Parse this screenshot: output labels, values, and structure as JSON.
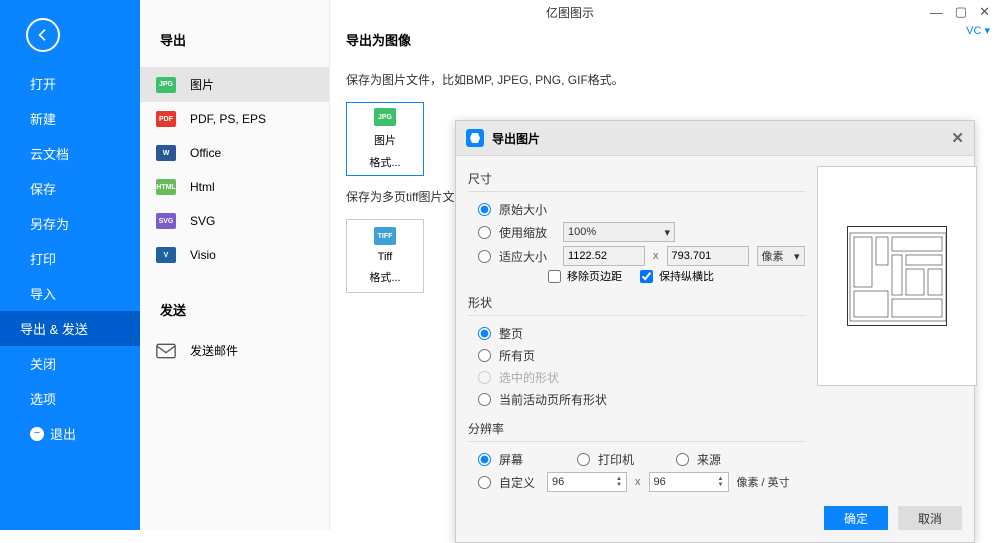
{
  "app": {
    "title": "亿图图示",
    "vc": "VC ▾"
  },
  "sidebar": {
    "items": [
      "打开",
      "新建",
      "云文档",
      "保存",
      "另存为",
      "打印",
      "导入",
      "导出 & 发送",
      "关闭",
      "选项"
    ],
    "exit": "退出"
  },
  "exportCol": {
    "title": "导出",
    "items": [
      {
        "icon": "JPG",
        "cls": "ic-jpg",
        "label": "图片"
      },
      {
        "icon": "PDF",
        "cls": "ic-pdf",
        "label": "PDF, PS, EPS"
      },
      {
        "icon": "W",
        "cls": "ic-word",
        "label": "Office"
      },
      {
        "icon": "HTML",
        "cls": "ic-html",
        "label": "Html"
      },
      {
        "icon": "SVG",
        "cls": "ic-svg",
        "label": "SVG"
      },
      {
        "icon": "V",
        "cls": "ic-visio",
        "label": "Visio"
      }
    ],
    "send": "发送",
    "sendItem": "发送邮件"
  },
  "content": {
    "header": "导出为图像",
    "desc1": "保存为图片文件，比如BMP, JPEG, PNG, GIF格式。",
    "tile1a": "图片",
    "tile1b": "格式...",
    "desc2": "保存为多页tiff图片文件。",
    "tile2a": "Tiff",
    "tile2b": "格式..."
  },
  "dialog": {
    "title": "导出图片",
    "size": {
      "title": "尺寸",
      "original": "原始大小",
      "scale": "使用缩放",
      "fit": "适应大小",
      "scaleVal": "100%",
      "w": "1122.52",
      "h": "793.701",
      "unit": "像素",
      "removeMargin": "移除页边距",
      "keepRatio": "保持纵横比"
    },
    "shape": {
      "title": "形状",
      "whole": "整页",
      "all": "所有页",
      "selected": "选中的形状",
      "active": "当前活动页所有形状"
    },
    "res": {
      "title": "分辨率",
      "screen": "屏幕",
      "printer": "打印机",
      "source": "来源",
      "custom": "自定义",
      "v1": "96",
      "v2": "96",
      "unit": "像素 / 英寸"
    },
    "ok": "确定",
    "cancel": "取消"
  }
}
